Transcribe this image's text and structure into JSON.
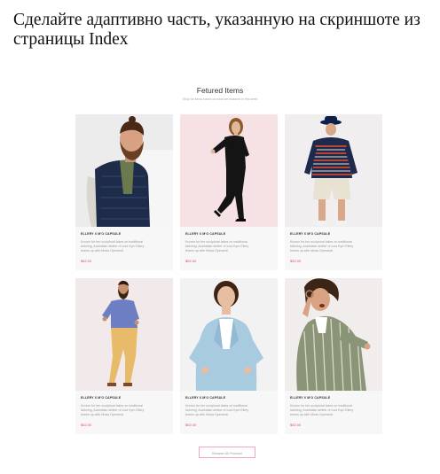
{
  "question": {
    "text": "Сделайте адаптивно часть, указанную на скриншоте из страницы Index"
  },
  "section": {
    "title": "Fetured Items",
    "subtitle": "Shop for items based on what we featured in this week"
  },
  "products": [
    {
      "name": "ELLERY X M'O CAPSULE",
      "description": "Known for her sculptural takes on traditional tailoring, Australian arbiter of cool Kym Ellery teams up with Moda Operandi.",
      "price": "$52.00",
      "image": "man-beard-puffer-jacket-photo",
      "background": "#efefef"
    },
    {
      "name": "ELLERY X M'O CAPSULE",
      "description": "Known for her sculptural takes on traditional tailoring, Australian arbiter of cool Kym Ellery teams up with Moda Operandi.",
      "price": "$52.00",
      "image": "woman-black-suit-photo",
      "background": "#f6e1e4"
    },
    {
      "name": "ELLERY X M'O CAPSULE",
      "description": "Known for her sculptural takes on traditional tailoring, Australian arbiter of cool Kym Ellery teams up with Moda Operandi.",
      "price": "$52.00",
      "image": "man-hat-striped-hoodie-photo",
      "background": "#f0eeee"
    },
    {
      "name": "ELLERY X M'O CAPSULE",
      "description": "Known for her sculptural takes on traditional tailoring, Australian arbiter of cool Kym Ellery teams up with Moda Operandi.",
      "price": "$52.00",
      "image": "man-purple-shirt-yellow-pants-photo",
      "background": "#f2e9ea"
    },
    {
      "name": "ELLERY X M'O CAPSULE",
      "description": "Known for her sculptural takes on traditional tailoring, Australian arbiter of cool Kym Ellery teams up with Moda Operandi.",
      "price": "$52.00",
      "image": "woman-light-blue-blazer-photo",
      "background": "#f2f2f2"
    },
    {
      "name": "ELLERY X M'O CAPSULE",
      "description": "Known for her sculptural takes on traditional tailoring, Australian arbiter of cool Kym Ellery teams up with Moda Operandi.",
      "price": "$52.00",
      "image": "woman-striped-shirt-photo",
      "background": "#f1eded"
    }
  ],
  "browse": {
    "label": "Browse All Product"
  },
  "colors": {
    "accent": "#e5476d",
    "button_border": "#f0a8b8"
  }
}
